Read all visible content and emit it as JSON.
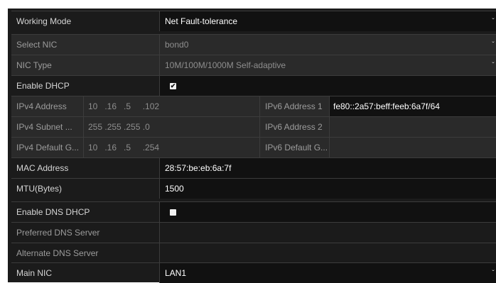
{
  "rows": {
    "working_mode": {
      "label": "Working Mode",
      "value": "Net Fault-tolerance"
    },
    "select_nic": {
      "label": "Select NIC",
      "value": "bond0"
    },
    "nic_type": {
      "label": "NIC Type",
      "value": "10M/100M/1000M Self-adaptive"
    },
    "enable_dhcp": {
      "label": "Enable DHCP",
      "checked": true,
      "check_glyph": "✔"
    },
    "ipv4_address": {
      "label": "IPv4 Address",
      "value": "10   .16   .5     .102"
    },
    "ipv4_subnet": {
      "label": "IPv4 Subnet ...",
      "value": "255 .255 .255 .0"
    },
    "ipv4_gateway": {
      "label": "IPv4 Default G...",
      "value": "10   .16   .5     .254"
    },
    "ipv6_address1": {
      "label": "IPv6 Address 1",
      "value": "fe80::2a57:beff:feeb:6a7f/64"
    },
    "ipv6_address2": {
      "label": "IPv6 Address 2",
      "value": ""
    },
    "ipv6_gateway": {
      "label": "IPv6 Default G...",
      "value": ""
    },
    "mac_address": {
      "label": "MAC Address",
      "value": "28:57:be:eb:6a:7f"
    },
    "mtu": {
      "label": "MTU(Bytes)",
      "value": "1500"
    },
    "enable_dns_dhcp": {
      "label": "Enable DNS DHCP",
      "checked": false
    },
    "preferred_dns": {
      "label": "Preferred DNS Server",
      "value": ""
    },
    "alternate_dns": {
      "label": "Alternate DNS Server",
      "value": ""
    },
    "main_nic": {
      "label": "Main NIC",
      "value": "LAN1"
    }
  },
  "icons": {
    "dropdown": "chevron-down-icon",
    "checkbox": "checkbox-icon"
  },
  "colors": {
    "panel_bg": "#1b1b1b",
    "field_grey": "#2a2a2a",
    "field_dark": "#111111",
    "label": "#9c9c9c",
    "value": "#ffffff"
  }
}
